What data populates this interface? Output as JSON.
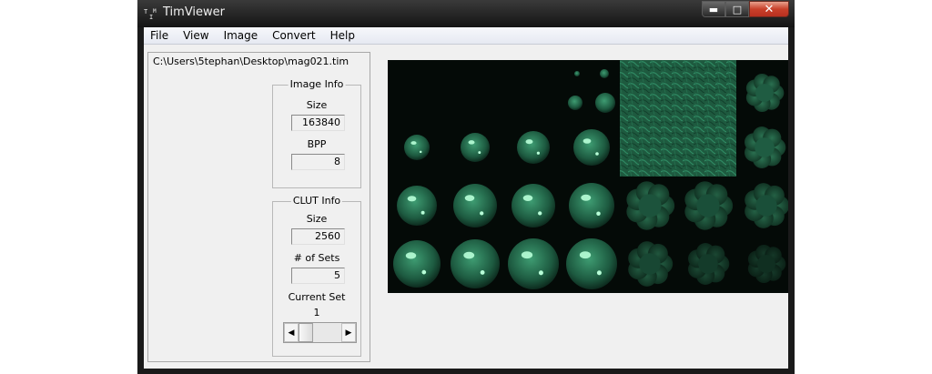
{
  "window": {
    "title": "TimViewer",
    "app_icon_glyph": "TIM"
  },
  "menu": [
    "File",
    "View",
    "Image",
    "Convert",
    "Help"
  ],
  "file_path": "C:\\Users\\5tephan\\Desktop\\mag021.tim",
  "image_info": {
    "title": "Image Info",
    "size_label": "Size",
    "size_value": "163840",
    "bpp_label": "BPP",
    "bpp_value": "8"
  },
  "clut_info": {
    "title": "CLUT Info",
    "size_label": "Size",
    "size_value": "2560",
    "sets_label": "# of Sets",
    "sets_value": "5",
    "current_set_label": "Current Set",
    "current_set_value": "1"
  },
  "caption_buttons": {
    "minimize_icon": "minimize-icon",
    "maximize_icon": "maximize-icon",
    "close_icon": "close-icon"
  },
  "image_colors": {
    "background": "#040a07",
    "tint": "#2f8a63",
    "highlight": "#a8ffd0"
  }
}
